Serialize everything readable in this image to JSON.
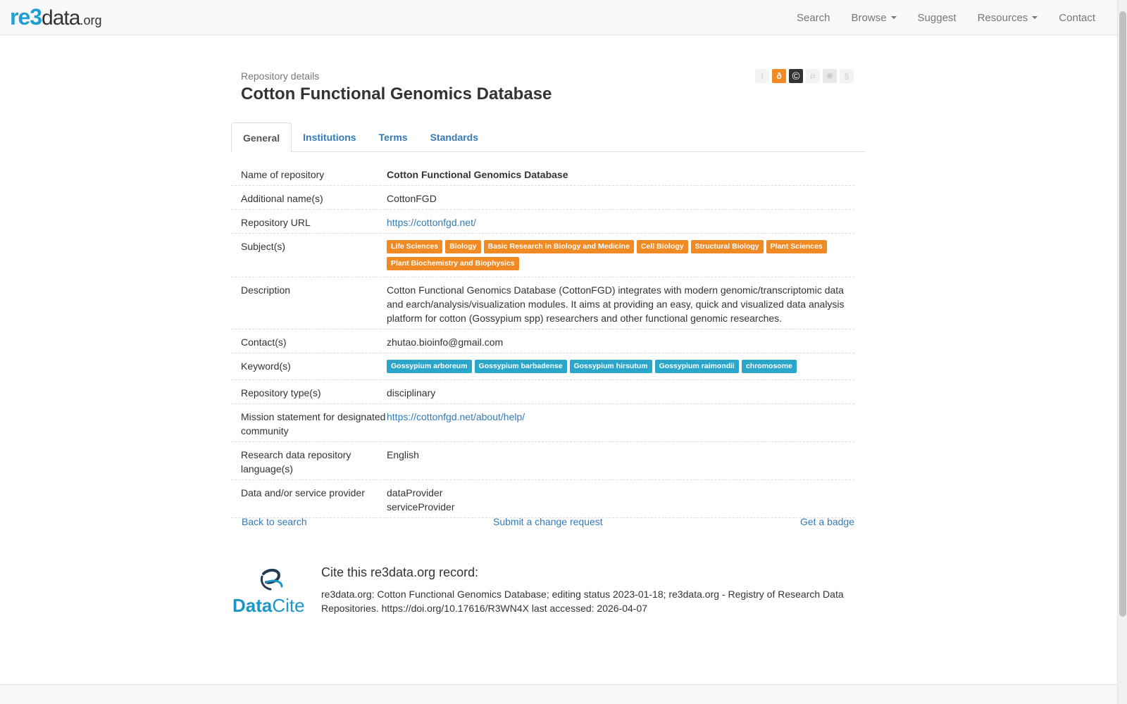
{
  "nav": {
    "logo_re": "re",
    "logo_three": "3",
    "logo_data": "data",
    "logo_org": ".org",
    "items": [
      "Search",
      "Browse",
      "Suggest",
      "Resources",
      "Contact"
    ]
  },
  "header": {
    "subtitle": "Repository details",
    "title": "Cotton Functional Genomics Database",
    "icons": [
      {
        "name": "info-icon",
        "glyph": "i"
      },
      {
        "name": "open-access-icon",
        "glyph": "ð"
      },
      {
        "name": "copyright-icon",
        "glyph": "©"
      },
      {
        "name": "pid-icon",
        "glyph": "pi"
      },
      {
        "name": "certificate-icon",
        "glyph": "✺"
      },
      {
        "name": "policy-icon",
        "glyph": "§"
      }
    ]
  },
  "tabs": [
    "General",
    "Institutions",
    "Terms",
    "Standards"
  ],
  "details": {
    "name_label": "Name of repository",
    "name_value": "Cotton Functional Genomics Database",
    "additional_label": "Additional name(s)",
    "additional_value": "CottonFGD",
    "url_label": "Repository URL",
    "url_value": "https://cottonfgd.net/",
    "subjects_label": "Subject(s)",
    "subjects": [
      "Life Sciences",
      "Biology",
      "Basic Research in Biology and Medicine",
      "Cell Biology",
      "Structural Biology",
      "Plant Sciences",
      "Plant Biochemistry and Biophysics"
    ],
    "description_label": "Description",
    "description_value": "Cotton Functional Genomics Database (CottonFGD) integrates with modern genomic/transcriptomic data and earch/analysis/visualization modules. It aims at providing an easy, quick and visualized data analysis platform for cotton (Gossypium spp) researchers and other functional genomic researches.",
    "contact_label": "Contact(s)",
    "contact_value": "zhutao.bioinfo@gmail.com",
    "keywords_label": "Keyword(s)",
    "keywords": [
      "Gossypium arboreum",
      "Gossypium barbadense",
      "Gossypium hirsutum",
      "Gossypium raimondii",
      "chromosome"
    ],
    "type_label": "Repository type(s)",
    "type_value": "disciplinary",
    "mission_label": "Mission statement for designated community",
    "mission_value": "https://cottonfgd.net/about/help/",
    "language_label": "Research data repository language(s)",
    "language_value": "English",
    "provider_label": "Data and/or service provider",
    "provider_values": [
      "dataProvider",
      "serviceProvider"
    ]
  },
  "actions": {
    "back": "Back to search",
    "submit": "Submit a change request",
    "badge": "Get a badge"
  },
  "cite": {
    "logo_data": "Data",
    "logo_cite": "Cite",
    "title": "Cite this re3data.org record:",
    "text": "re3data.org: Cotton Functional Genomics Database; editing status 2023-01-18; re3data.org - Registry of Research Data Repositories. https://doi.org/10.17616/R3WN4X last accessed: 2026-04-07"
  },
  "colors": {
    "subject_badge": "#f08a24",
    "keyword_badge": "#2ba6cb",
    "link": "#337ab7"
  }
}
